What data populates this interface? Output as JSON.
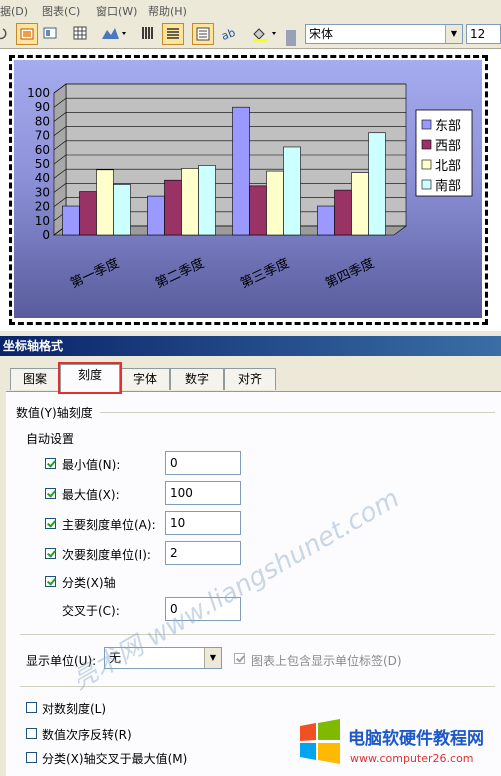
{
  "menu": [
    "据(D)",
    "图表(C)",
    "窗口(W)",
    "帮助(H)"
  ],
  "toolbar": {
    "font_name": "宋体",
    "font_size": "12"
  },
  "chart_data": {
    "type": "bar",
    "categories": [
      "第一季度",
      "第二季度",
      "第三季度",
      "第四季度"
    ],
    "series": [
      {
        "name": "东部",
        "values": [
          20.4,
          27.4,
          90,
          20.4
        ],
        "color": "#9999ff"
      },
      {
        "name": "西部",
        "values": [
          30.6,
          38.6,
          34.6,
          31.6
        ],
        "color": "#993366"
      },
      {
        "name": "北部",
        "values": [
          45.9,
          46.9,
          45,
          43.9
        ],
        "color": "#ffffcc"
      },
      {
        "name": "南部",
        "values": [
          35.6,
          49,
          62,
          72
        ],
        "color": "#ccffff"
      }
    ],
    "ylim": [
      0,
      100
    ],
    "yticks": [
      "0",
      "10",
      "20",
      "30",
      "40",
      "50",
      "60",
      "70",
      "80",
      "90",
      "100"
    ],
    "grid": true,
    "legend": "right"
  },
  "dialog": {
    "title": "坐标轴格式",
    "tabs": [
      "图案",
      "刻度",
      "字体",
      "数字",
      "对齐"
    ],
    "selected_tab": "刻度",
    "section_label": "数值(Y)轴刻度",
    "auto_label": "自动设置",
    "min_label": "最小值(N):",
    "min_value": "0",
    "max_label": "最大值(X):",
    "max_value": "100",
    "major_label": "主要刻度单位(A):",
    "major_value": "10",
    "minor_label": "次要刻度单位(I):",
    "minor_value": "2",
    "category_label": "分类(X)轴",
    "cross_label": "交叉于(C):",
    "cross_value": "0",
    "display_units_label": "显示单位(U):",
    "display_units_value": "无",
    "show_units_label": "图表上包含显示单位标签(D)",
    "log_scale_label": "对数刻度(L)",
    "reverse_label": "数值次序反转(R)",
    "cross_max_label": "分类(X)轴交叉于最大值(M)"
  },
  "watermark": {
    "text": "亮术网 www.liangshunet.com"
  },
  "logo": {
    "title": "电脑软硬件教程网",
    "url": "www.computer26.com"
  }
}
